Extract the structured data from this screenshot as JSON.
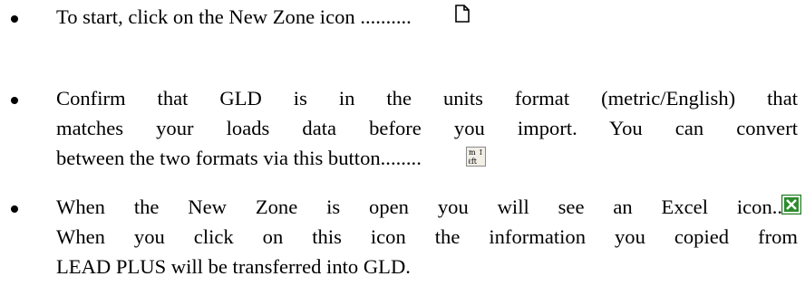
{
  "items": [
    {
      "lines": [
        "To start, click on the New Zone icon .........."
      ],
      "icon": "new-document-icon"
    },
    {
      "lines": [
        "Confirm that GLD is in the units format (metric/English) that",
        "matches your loads data before you import. You can convert",
        "between the two formats via this button........"
      ],
      "icon": "metric-english-toggle-icon",
      "icon_glyph": "m↕ft"
    },
    {
      "lines": [
        "When the New Zone is open you will see an Excel icon.....",
        "When you click on this icon the information you copied from",
        "LEAD PLUS will be transferred into GLD."
      ],
      "icon": "excel-icon",
      "icon_color": "#1f7a1f"
    }
  ]
}
